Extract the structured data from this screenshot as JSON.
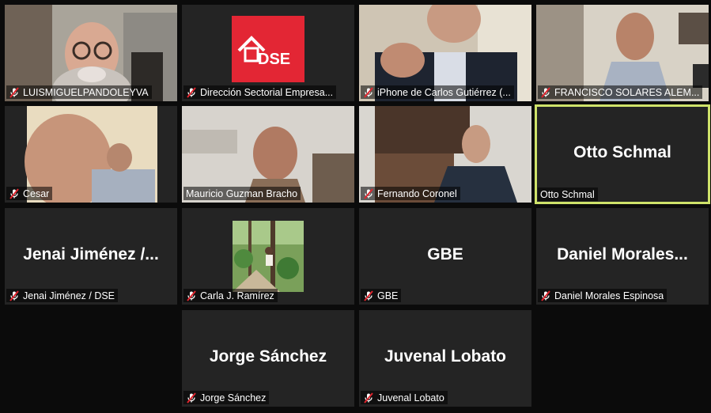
{
  "colors": {
    "tile_bg": "#242424",
    "active_speaker_border": "#cfe36a",
    "muted_icon": "#e0252e",
    "dse_logo_bg": "#e32634"
  },
  "tiles": [
    {
      "label": "LUISMIGUELPANDOLEYVA",
      "video": true
    },
    {
      "label": "Dirección Sectorial Empresa...",
      "video": true,
      "logo_text": "DSE"
    },
    {
      "label": "iPhone de Carlos Gutiérrez (...",
      "video": true
    },
    {
      "label": "FRANCISCO SOLARES ALEM...",
      "video": true
    },
    {
      "label": "Cesar",
      "video": true
    },
    {
      "label": "Mauricio Guzman Bracho",
      "video": true
    },
    {
      "label": "Fernando Coronel",
      "video": true
    },
    {
      "label": "Otto Schmal",
      "display_name": "Otto Schmal",
      "video": false,
      "active_speaker": true
    },
    {
      "label": "Jenai Jiménez / DSE",
      "display_name": "Jenai  Jiménez /...",
      "video": false
    },
    {
      "label": "Carla J. Ramírez",
      "video": false,
      "avatar_photo": true
    },
    {
      "label": "GBE",
      "display_name": "GBE",
      "video": false
    },
    {
      "label": "Daniel Morales Espinosa",
      "display_name": "Daniel  Morales...",
      "video": false
    },
    {
      "label": "Jorge Sánchez",
      "display_name": "Jorge Sánchez",
      "video": false
    },
    {
      "label": "Juvenal Lobato",
      "display_name": "Juvenal Lobato",
      "video": false
    }
  ]
}
